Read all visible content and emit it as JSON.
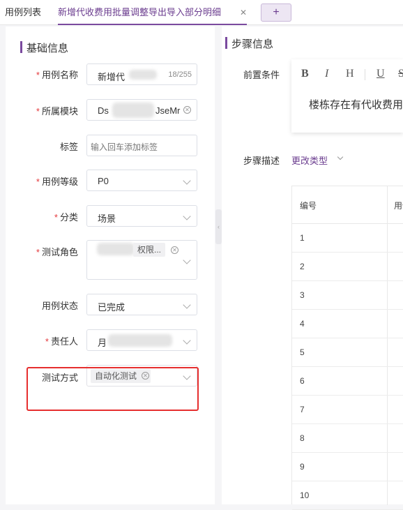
{
  "tabs": {
    "list_label": "用例列表",
    "active_label": "新增代收费用批量调整导出导入部分明细",
    "close_icon": "close-icon",
    "add_icon": "plus-icon",
    "add_label": "+"
  },
  "basic": {
    "title": "基础信息",
    "required_mark": "*",
    "fields": {
      "name": {
        "label": "用例名称",
        "value": "新增代",
        "count": "18/255"
      },
      "module": {
        "label": "所属模块",
        "value_start": "Ds",
        "value_end": "JseMr"
      },
      "tags": {
        "label": "标签",
        "placeholder": "输入回车添加标签"
      },
      "level": {
        "label": "用例等级",
        "value": "P0"
      },
      "category": {
        "label": "分类",
        "value": "场景"
      },
      "role": {
        "label": "测试角色",
        "tag_text": "权限..."
      },
      "status": {
        "label": "用例状态",
        "value": "已完成"
      },
      "owner": {
        "label": "责任人",
        "value": "月"
      },
      "method": {
        "label": "测试方式",
        "tag_text": "自动化测试"
      }
    }
  },
  "steps": {
    "title": "步骤信息",
    "pre_label": "前置条件",
    "toolbar": {
      "bold": "B",
      "italic": "I",
      "heading": "H",
      "underline": "U",
      "strike": "S"
    },
    "pre_text": "楼栋存在有代收费用",
    "desc_label": "步骤描述",
    "change_type": "更改类型",
    "table": {
      "headers": [
        "编号",
        "用例"
      ],
      "rows": [
        "1",
        "2",
        "3",
        "4",
        "5",
        "6",
        "7",
        "8",
        "9",
        "10"
      ]
    }
  },
  "colors": {
    "accent": "#7a4a9e",
    "required": "#e4393c",
    "highlight_box": "#e62e2e"
  }
}
